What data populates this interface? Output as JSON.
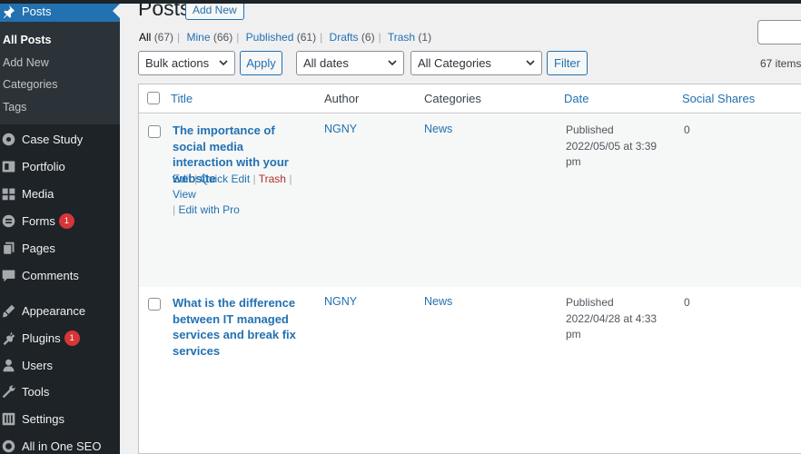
{
  "sidebar": {
    "posts_label": "Posts",
    "submenu": [
      "All Posts",
      "Add New",
      "Categories",
      "Tags"
    ],
    "items": [
      {
        "label": "Case Study",
        "icon": "portfolio-icon"
      },
      {
        "label": "Portfolio",
        "icon": "portfolio-icon"
      },
      {
        "label": "Media",
        "icon": "media-icon"
      },
      {
        "label": "Forms",
        "icon": "forms-icon",
        "badge": "1"
      },
      {
        "label": "Pages",
        "icon": "pages-icon"
      },
      {
        "label": "Comments",
        "icon": "comments-icon"
      },
      {
        "label": "Appearance",
        "icon": "appearance-icon"
      },
      {
        "label": "Plugins",
        "icon": "plugins-icon",
        "badge": "1"
      },
      {
        "label": "Users",
        "icon": "users-icon"
      },
      {
        "label": "Tools",
        "icon": "tools-icon"
      },
      {
        "label": "Settings",
        "icon": "settings-icon"
      },
      {
        "label": "All in One SEO",
        "icon": "seo-icon"
      }
    ]
  },
  "header": {
    "title": "Posts",
    "add_new_label": "Add New"
  },
  "filters_links": [
    {
      "label": "All",
      "count": "(67)"
    },
    {
      "label": "Mine",
      "count": "(66)"
    },
    {
      "label": "Published",
      "count": "(61)"
    },
    {
      "label": "Drafts",
      "count": "(6)"
    },
    {
      "label": "Trash",
      "count": "(1)"
    }
  ],
  "toolbar": {
    "bulk_actions": "Bulk actions",
    "apply_label": "Apply",
    "dates": "All dates",
    "categories": "All Categories",
    "filter_label": "Filter",
    "items_count": "67 items"
  },
  "columns": [
    "Title",
    "Author",
    "Categories",
    "Date",
    "Social Shares"
  ],
  "rows": [
    {
      "title": "The importance of social media interaction with your website",
      "author": "NGNY",
      "category": "News",
      "status": "Published",
      "date": "2022/05/05 at 3:39 pm",
      "shares": "0",
      "actions": {
        "edit": "Edit",
        "quick_edit": "Quick Edit",
        "trash": "Trash",
        "view": "View",
        "edit_pro": "Edit with Pro"
      }
    },
    {
      "title": "What is the difference between IT managed services and break fix services",
      "author": "NGNY",
      "category": "News",
      "status": "Published",
      "date": "2022/04/28 at 4:33 pm",
      "shares": "0"
    }
  ],
  "colors": {
    "sidebar_bg": "#1d2327",
    "submenu_bg": "#2c3338",
    "accent": "#2271b1",
    "badge": "#d63638",
    "trash": "#b32d2e"
  }
}
